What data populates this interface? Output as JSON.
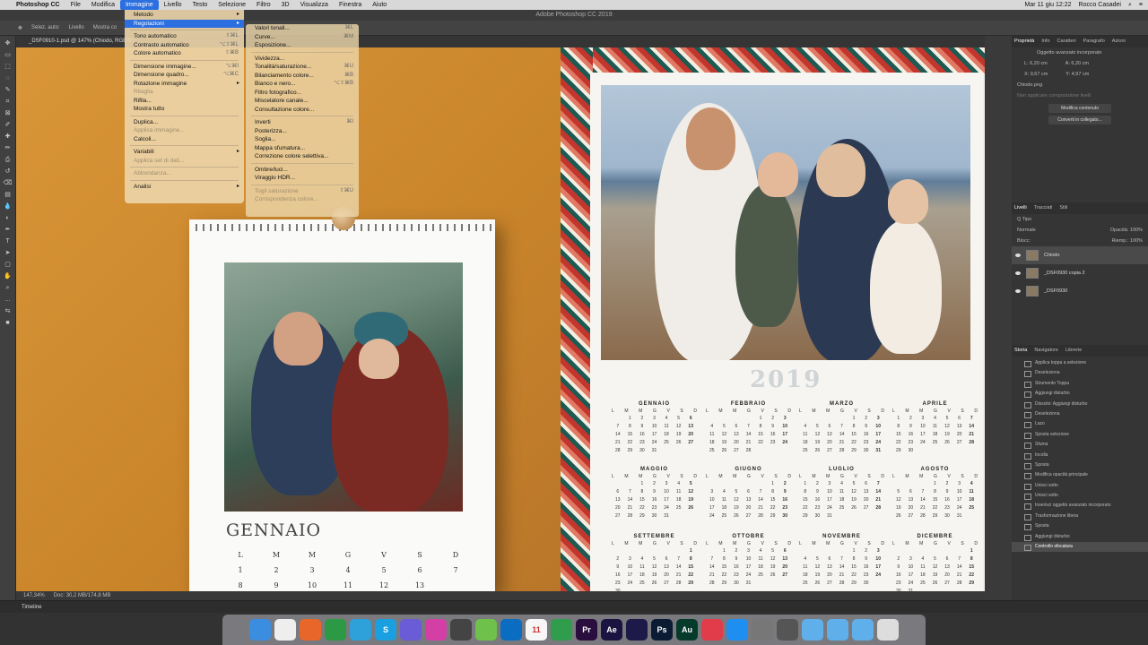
{
  "menubar": {
    "app": "Photoshop CC",
    "items": [
      "File",
      "Modifica",
      "Immagine",
      "Livello",
      "Testo",
      "Selezione",
      "Filtro",
      "3D",
      "Visualizza",
      "Finestra",
      "Aiuto"
    ],
    "active": "Immagine",
    "datetime": "Mar 11 giu 12:22",
    "user": "Rocco Casadei"
  },
  "window_title": "Adobe Photoshop CC 2019",
  "options": {
    "autoselect": "Selez. auto:",
    "layer": "Livello",
    "show": "Mostra co"
  },
  "doc_tab": "_DSF0910-1.psd @ 147% (Chiodo, RGB/8*)",
  "menu_image": [
    {
      "label": "Metodo",
      "arrow": true
    },
    {
      "label": "Regolazioni",
      "arrow": true,
      "hl": true
    },
    {
      "sep": true
    },
    {
      "label": "Tono automatico",
      "sc": "⇧⌘L"
    },
    {
      "label": "Contrasto automatico",
      "sc": "⌥⇧⌘L"
    },
    {
      "label": "Colore automatico",
      "sc": "⇧⌘B"
    },
    {
      "sep": true
    },
    {
      "label": "Dimensione immagine...",
      "sc": "⌥⌘I"
    },
    {
      "label": "Dimensione quadro...",
      "sc": "⌥⌘C"
    },
    {
      "label": "Rotazione immagine",
      "arrow": true
    },
    {
      "label": "Ritaglia",
      "dis": true
    },
    {
      "label": "Rifila..."
    },
    {
      "label": "Mostra tutto"
    },
    {
      "sep": true
    },
    {
      "label": "Duplica..."
    },
    {
      "label": "Applica immagine...",
      "dis": true
    },
    {
      "label": "Calcoli..."
    },
    {
      "sep": true
    },
    {
      "label": "Variabili",
      "arrow": true
    },
    {
      "label": "Applica set di dati...",
      "dis": true
    },
    {
      "sep": true
    },
    {
      "label": "Abbondanza...",
      "dis": true
    },
    {
      "sep": true
    },
    {
      "label": "Analisi",
      "arrow": true
    }
  ],
  "menu_adjust": [
    {
      "label": "Valori tonali...",
      "sc": "⌘L"
    },
    {
      "label": "Curve...",
      "sc": "⌘M"
    },
    {
      "label": "Esposizione..."
    },
    {
      "sep": true
    },
    {
      "label": "Vividezza..."
    },
    {
      "label": "Tonalità/saturazione...",
      "sc": "⌘U"
    },
    {
      "label": "Bilanciamento colore...",
      "sc": "⌘B"
    },
    {
      "label": "Bianco e nero...",
      "sc": "⌥⇧⌘B"
    },
    {
      "label": "Filtro fotografico..."
    },
    {
      "label": "Miscelatore canale..."
    },
    {
      "label": "Consultazione colore..."
    },
    {
      "sep": true
    },
    {
      "label": "Inverti",
      "sc": "⌘I"
    },
    {
      "label": "Posterizza..."
    },
    {
      "label": "Soglia..."
    },
    {
      "label": "Mappa sfumatura..."
    },
    {
      "label": "Correzione colore selettiva..."
    },
    {
      "sep": true
    },
    {
      "label": "Ombre/luci..."
    },
    {
      "label": "Viraggio HDR..."
    },
    {
      "sep": true
    },
    {
      "label": "Togli saturazione",
      "sc": "⇧⌘U",
      "dis": true
    },
    {
      "label": "Corrispondenza colore...",
      "dis": true
    }
  ],
  "year": "2019",
  "weekdays": [
    "L",
    "M",
    "M",
    "G",
    "V",
    "S",
    "D"
  ],
  "months": [
    {
      "name": "GENNAIO",
      "days": [
        "",
        "1",
        "2",
        "3",
        "4",
        "5",
        "6",
        "7",
        "8",
        "9",
        "10",
        "11",
        "12",
        "13",
        "14",
        "15",
        "16",
        "17",
        "18",
        "19",
        "20",
        "21",
        "22",
        "23",
        "24",
        "25",
        "26",
        "27",
        "28",
        "29",
        "30",
        "31"
      ]
    },
    {
      "name": "FEBBRAIO",
      "days": [
        "",
        "",
        "",
        "",
        "1",
        "2",
        "3",
        "4",
        "5",
        "6",
        "7",
        "8",
        "9",
        "10",
        "11",
        "12",
        "13",
        "14",
        "15",
        "16",
        "17",
        "18",
        "19",
        "20",
        "21",
        "22",
        "23",
        "24",
        "25",
        "26",
        "27",
        "28"
      ]
    },
    {
      "name": "MARZO",
      "days": [
        "",
        "",
        "",
        "",
        "1",
        "2",
        "3",
        "4",
        "5",
        "6",
        "7",
        "8",
        "9",
        "10",
        "11",
        "12",
        "13",
        "14",
        "15",
        "16",
        "17",
        "18",
        "19",
        "20",
        "21",
        "22",
        "23",
        "24",
        "25",
        "26",
        "27",
        "28",
        "29",
        "30",
        "31"
      ]
    },
    {
      "name": "APRILE",
      "days": [
        "1",
        "2",
        "3",
        "4",
        "5",
        "6",
        "7",
        "8",
        "9",
        "10",
        "11",
        "12",
        "13",
        "14",
        "15",
        "16",
        "17",
        "18",
        "19",
        "20",
        "21",
        "22",
        "23",
        "24",
        "25",
        "26",
        "27",
        "28",
        "29",
        "30"
      ]
    },
    {
      "name": "MAGGIO",
      "days": [
        "",
        "",
        "1",
        "2",
        "3",
        "4",
        "5",
        "6",
        "7",
        "8",
        "9",
        "10",
        "11",
        "12",
        "13",
        "14",
        "15",
        "16",
        "17",
        "18",
        "19",
        "20",
        "21",
        "22",
        "23",
        "24",
        "25",
        "26",
        "27",
        "28",
        "29",
        "30",
        "31"
      ]
    },
    {
      "name": "GIUGNO",
      "days": [
        "",
        "",
        "",
        "",
        "",
        "1",
        "2",
        "3",
        "4",
        "5",
        "6",
        "7",
        "8",
        "9",
        "10",
        "11",
        "12",
        "13",
        "14",
        "15",
        "16",
        "17",
        "18",
        "19",
        "20",
        "21",
        "22",
        "23",
        "24",
        "25",
        "26",
        "27",
        "28",
        "29",
        "30"
      ]
    },
    {
      "name": "LUGLIO",
      "days": [
        "1",
        "2",
        "3",
        "4",
        "5",
        "6",
        "7",
        "8",
        "9",
        "10",
        "11",
        "12",
        "13",
        "14",
        "15",
        "16",
        "17",
        "18",
        "19",
        "20",
        "21",
        "22",
        "23",
        "24",
        "25",
        "26",
        "27",
        "28",
        "29",
        "30",
        "31"
      ]
    },
    {
      "name": "AGOSTO",
      "days": [
        "",
        "",
        "",
        "1",
        "2",
        "3",
        "4",
        "5",
        "6",
        "7",
        "8",
        "9",
        "10",
        "11",
        "12",
        "13",
        "14",
        "15",
        "16",
        "17",
        "18",
        "19",
        "20",
        "21",
        "22",
        "23",
        "24",
        "25",
        "26",
        "27",
        "28",
        "29",
        "30",
        "31"
      ]
    },
    {
      "name": "SETTEMBRE",
      "days": [
        "",
        "",
        "",
        "",
        "",
        "",
        "1",
        "2",
        "3",
        "4",
        "5",
        "6",
        "7",
        "8",
        "9",
        "10",
        "11",
        "12",
        "13",
        "14",
        "15",
        "16",
        "17",
        "18",
        "19",
        "20",
        "21",
        "22",
        "23",
        "24",
        "25",
        "26",
        "27",
        "28",
        "29",
        "30"
      ]
    },
    {
      "name": "OTTOBRE",
      "days": [
        "",
        "1",
        "2",
        "3",
        "4",
        "5",
        "6",
        "7",
        "8",
        "9",
        "10",
        "11",
        "12",
        "13",
        "14",
        "15",
        "16",
        "17",
        "18",
        "19",
        "20",
        "21",
        "22",
        "23",
        "24",
        "25",
        "26",
        "27",
        "28",
        "29",
        "30",
        "31"
      ]
    },
    {
      "name": "NOVEMBRE",
      "days": [
        "",
        "",
        "",
        "",
        "1",
        "2",
        "3",
        "4",
        "5",
        "6",
        "7",
        "8",
        "9",
        "10",
        "11",
        "12",
        "13",
        "14",
        "15",
        "16",
        "17",
        "18",
        "19",
        "20",
        "21",
        "22",
        "23",
        "24",
        "25",
        "26",
        "27",
        "28",
        "29",
        "30"
      ]
    },
    {
      "name": "DICEMBRE",
      "days": [
        "",
        "",
        "",
        "",
        "",
        "",
        "1",
        "2",
        "3",
        "4",
        "5",
        "6",
        "7",
        "8",
        "9",
        "10",
        "11",
        "12",
        "13",
        "14",
        "15",
        "16",
        "17",
        "18",
        "19",
        "20",
        "21",
        "22",
        "23",
        "24",
        "25",
        "26",
        "27",
        "28",
        "29",
        "30",
        "31"
      ]
    }
  ],
  "small_cal": {
    "title": "GENNAIO",
    "days": [
      "1",
      "2",
      "3",
      "4",
      "5",
      "6",
      "7",
      "8",
      "9",
      "10",
      "11",
      "12",
      "13"
    ]
  },
  "status": {
    "zoom": "147,34%",
    "doc": "Doc: 30,2 MB/174,8 MB"
  },
  "timeline": "Timeline",
  "props": {
    "tabs": [
      "Proprietà",
      "Info",
      "Caratteri",
      "Paragrafo",
      "Azioni"
    ],
    "kind": "Oggetto avanzato incorporato",
    "w": "L: 6,20 cm",
    "h": "A: 6,20 cm",
    "x": "X: 9,67 cm",
    "y": "Y: 4,97 cm",
    "file": "Chiodo.png",
    "comp": "Non applicare composizione livelli",
    "btn_edit": "Modifica contenuto",
    "btn_convert": "Converti in collegato..."
  },
  "layers": {
    "tabs": [
      "Livelli",
      "Tracciati",
      "Stili"
    ],
    "filter": "Q Tipo",
    "blend": "Normale",
    "opacity_label": "Opacità:",
    "opacity": "100%",
    "lock_label": "Blocc:",
    "fill_label": "Riemp.:",
    "fill": "100%",
    "items": [
      "Chiodo",
      "_DSF0930 copia 2",
      "_DSF0930"
    ]
  },
  "history": {
    "tabs": [
      "Storia",
      "Navigatore",
      "Librerie"
    ],
    "items": [
      "Applica toppa a selezione",
      "Deseleziona",
      "Strumento Toppa",
      "Aggiungi disturbo",
      "Dissolvi: Aggiungi disturbo",
      "Deseleziona",
      "Lazo",
      "Sposta selezione",
      "Sfuma",
      "Incolla",
      "Sposta",
      "Modifica opacità principale",
      "Unisci sotto",
      "Unisci sotto",
      "Inserisci oggetto avanzato incorporato",
      "Trasformazione libera",
      "Sposta",
      "Aggiungi disturbo",
      "Controllo sfocatura"
    ]
  },
  "dock": [
    {
      "n": "finder-icon",
      "c": "#3b8de0",
      "t": ""
    },
    {
      "n": "clock-icon",
      "c": "#eee",
      "t": ""
    },
    {
      "n": "firefox-icon",
      "c": "#e8662a",
      "t": ""
    },
    {
      "n": "chrome-icon",
      "c": "#2c9a45",
      "t": ""
    },
    {
      "n": "telegram-icon",
      "c": "#2ea0da",
      "t": ""
    },
    {
      "n": "skype-icon",
      "c": "#1a9fe0",
      "t": "S"
    },
    {
      "n": "archive-icon",
      "c": "#6a5bd6",
      "t": ""
    },
    {
      "n": "cleaner-icon",
      "c": "#d43fa5",
      "t": ""
    },
    {
      "n": "disk-icon",
      "c": "#444",
      "t": ""
    },
    {
      "n": "notes-icon",
      "c": "#6ec14a",
      "t": ""
    },
    {
      "n": "trello-icon",
      "c": "#0a6dc1",
      "t": ""
    },
    {
      "n": "calendar-icon",
      "c": "#f6f6f6",
      "t": "11"
    },
    {
      "n": "numbers-icon",
      "c": "#2f9d4b",
      "t": ""
    },
    {
      "n": "premiere-icon",
      "c": "#2a0f3e",
      "t": "Pr"
    },
    {
      "n": "aftereffects-icon",
      "c": "#1b1440",
      "t": "Ae"
    },
    {
      "n": "media-encoder-icon",
      "c": "#1d1a4a",
      "t": ""
    },
    {
      "n": "photoshop-icon",
      "c": "#0a1b33",
      "t": "Ps"
    },
    {
      "n": "audition-icon",
      "c": "#063b2b",
      "t": "Au"
    },
    {
      "n": "screen-icon",
      "c": "#e23b4a",
      "t": ""
    },
    {
      "n": "appstore-icon",
      "c": "#1f8ef1",
      "t": ""
    },
    {
      "n": "settings-icon",
      "c": "#777",
      "t": ""
    },
    {
      "n": "gamecenter-icon",
      "c": "#555",
      "t": ""
    },
    {
      "n": "folder-icon",
      "c": "#5fb0ea",
      "t": ""
    },
    {
      "n": "folder-icon-2",
      "c": "#5fb0ea",
      "t": ""
    },
    {
      "n": "downloads-icon",
      "c": "#5fb0ea",
      "t": ""
    },
    {
      "n": "trash-icon",
      "c": "#ddd",
      "t": ""
    }
  ]
}
